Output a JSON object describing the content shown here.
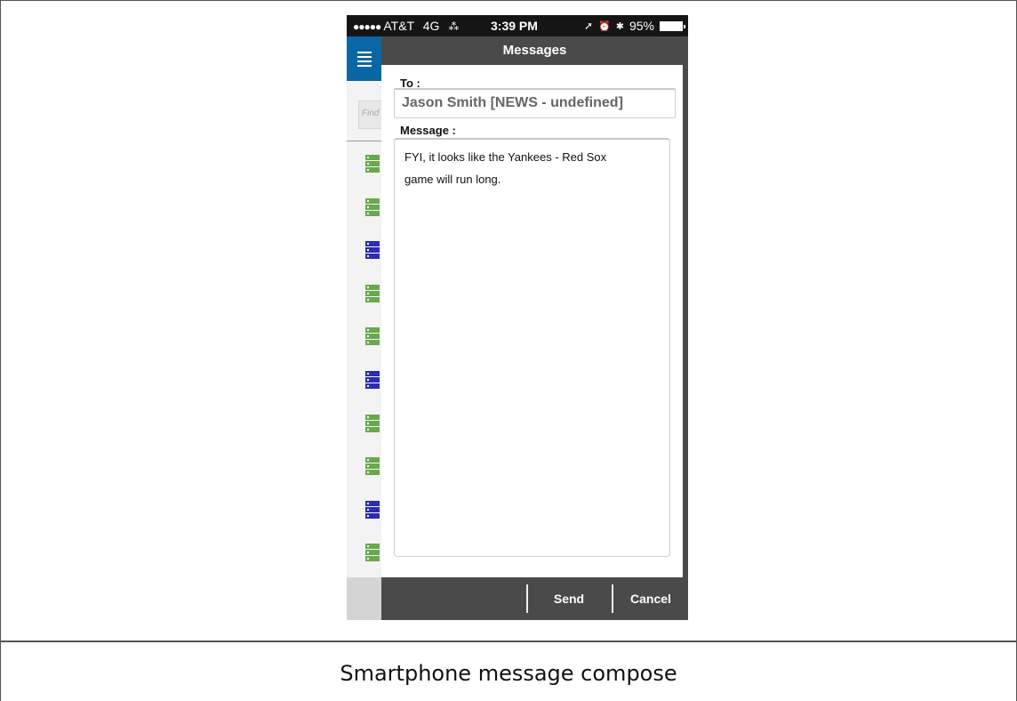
{
  "status_bar": {
    "signal_dots": "●●●●●",
    "carrier": "AT&T",
    "network": "4G",
    "activity": "⁂",
    "time": "3:39 PM",
    "location_glyph": "➚",
    "alarm_glyph": "⏰",
    "bluetooth_glyph": "✱",
    "battery": "95%"
  },
  "sidebar": {
    "search_placeholder": "Find",
    "server_icons": [
      "green",
      "green",
      "blue",
      "green",
      "green",
      "blue",
      "green",
      "green",
      "blue",
      "green"
    ]
  },
  "header": {
    "title": "Messages"
  },
  "compose": {
    "to_label": "To :",
    "to_value": "Jason Smith [NEWS - undefined]",
    "message_label": "Message :",
    "message_line1": "FYI, it looks like the Yankees - Red Sox",
    "message_line2": "game will run long."
  },
  "actions": {
    "send_label": "Send",
    "cancel_label": "Cancel"
  },
  "caption": "Smartphone message compose",
  "colors": {
    "menu_blue": "#0a67a6",
    "server_green": "#6aa84f",
    "server_blue": "#2b2bb5",
    "toolbar": "#4a4a4a"
  }
}
